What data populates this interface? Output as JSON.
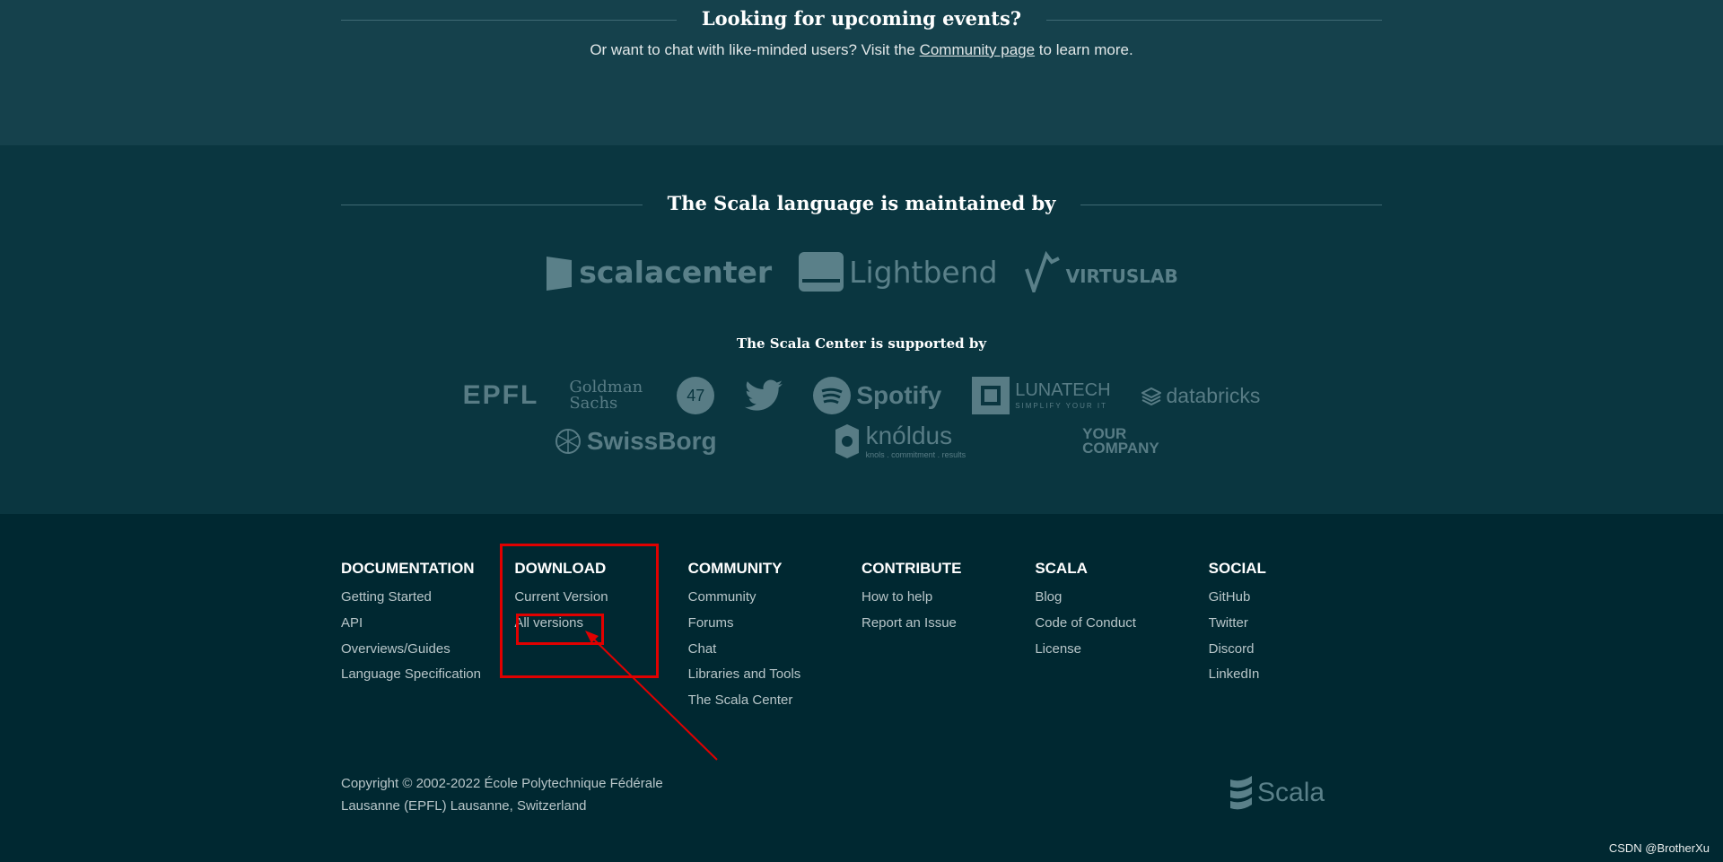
{
  "events": {
    "title": "Looking for upcoming events?",
    "text_before": "Or want to chat with like-minded users? Visit the ",
    "link": "Community page",
    "text_after": " to learn more."
  },
  "maintainers": {
    "title": "The Scala language is maintained by",
    "logos": [
      "scalacenter",
      "Lightbend",
      "VIRTUSLAB"
    ]
  },
  "supporters": {
    "title": "The Scala Center is supported by",
    "row1": [
      "EPFL",
      "Goldman Sachs",
      "47",
      "Twitter",
      "Spotify",
      "LUNATECH",
      "SIMPLIFY YOUR IT",
      "databricks"
    ],
    "row2": [
      "SwissBorg",
      "knóldus",
      "knols . commitment . results",
      "YOUR COMPANY"
    ]
  },
  "footer": {
    "columns": [
      {
        "title": "DOCUMENTATION",
        "links": [
          "Getting Started",
          "API",
          "Overviews/Guides",
          "Language Specification"
        ]
      },
      {
        "title": "DOWNLOAD",
        "links": [
          "Current Version",
          "All versions"
        ]
      },
      {
        "title": "COMMUNITY",
        "links": [
          "Community",
          "Forums",
          "Chat",
          "Libraries and Tools",
          "The Scala Center"
        ]
      },
      {
        "title": "CONTRIBUTE",
        "links": [
          "How to help",
          "Report an Issue"
        ]
      },
      {
        "title": "SCALA",
        "links": [
          "Blog",
          "Code of Conduct",
          "License"
        ]
      },
      {
        "title": "SOCIAL",
        "links": [
          "GitHub",
          "Twitter",
          "Discord",
          "LinkedIn"
        ]
      }
    ],
    "copyright_line1": "Copyright © 2002-2022 École Polytechnique Fédérale",
    "copyright_line2": "Lausanne (EPFL) Lausanne, Switzerland",
    "logo_text": "Scala"
  },
  "annotation": {
    "color": "#e00000"
  },
  "watermark": "CSDN @BrotherXu"
}
